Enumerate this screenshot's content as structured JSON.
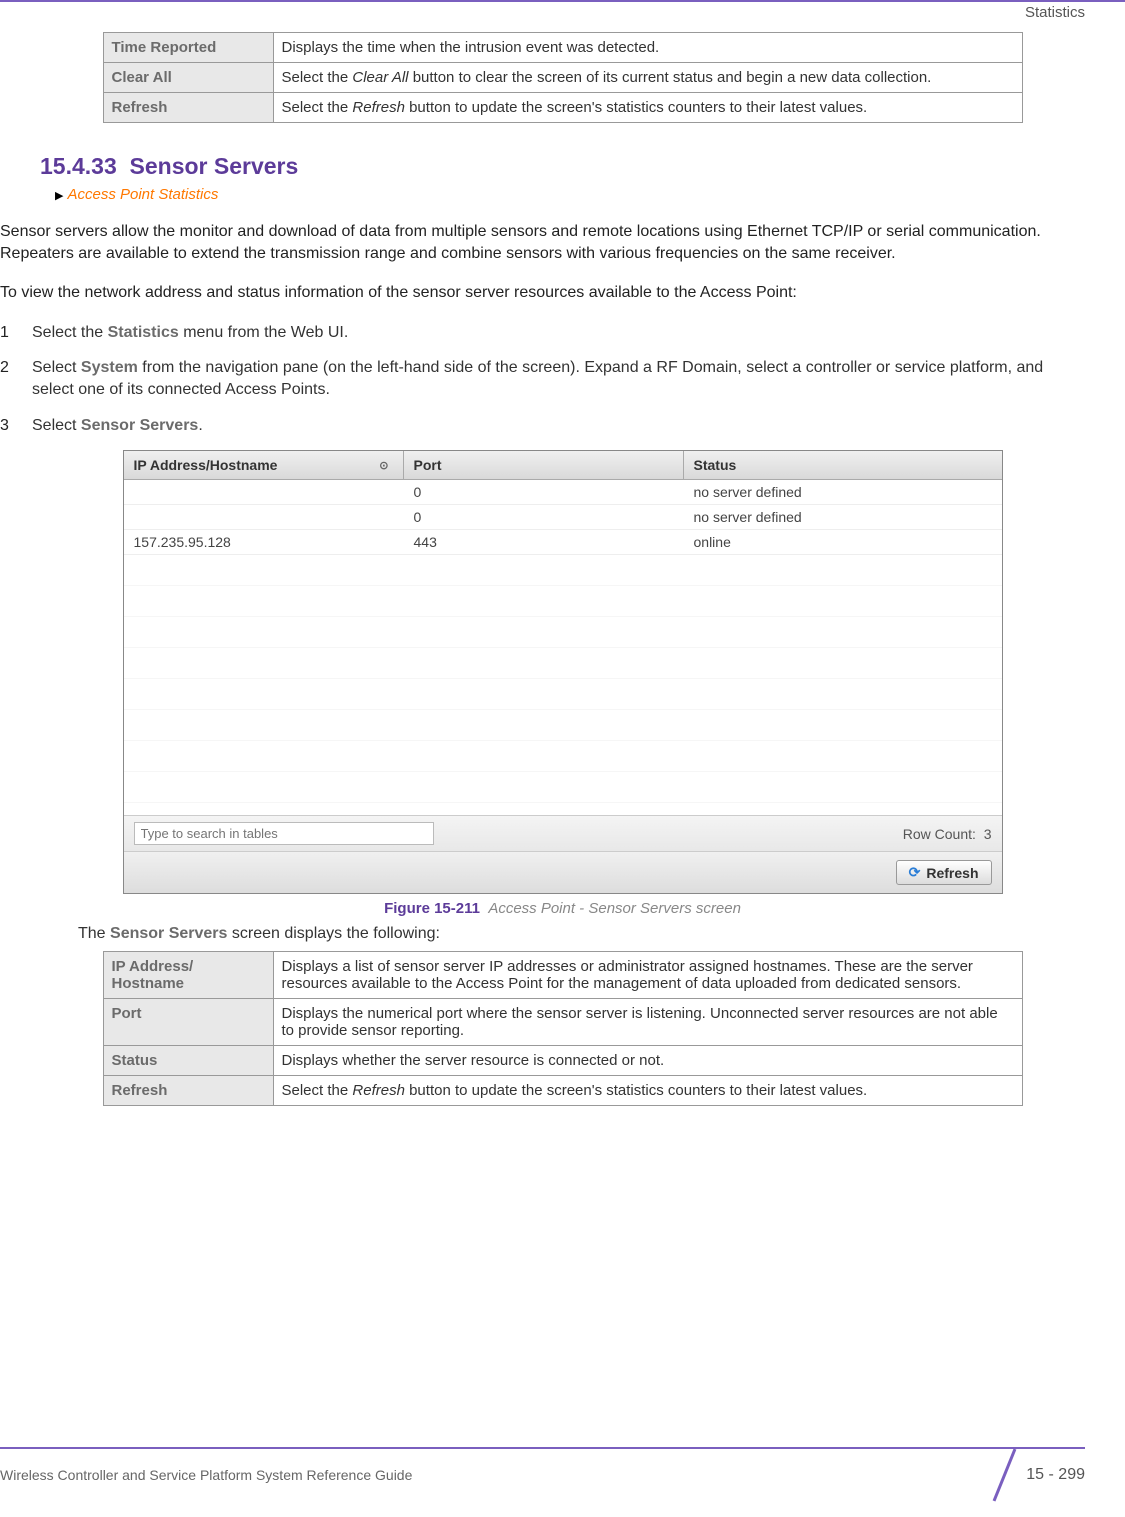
{
  "header": {
    "section_label": "Statistics"
  },
  "table1": {
    "rows": [
      {
        "label": "Time Reported",
        "desc": "Displays the time when the intrusion event was detected."
      },
      {
        "label": "Clear All",
        "desc_parts": [
          "Select the ",
          "Clear All",
          " button to clear the screen of its current status and begin a new data collection."
        ]
      },
      {
        "label": "Refresh",
        "desc_parts": [
          "Select the ",
          "Refresh",
          " button to update the screen's statistics counters to their latest values."
        ]
      }
    ]
  },
  "section": {
    "number": "15.4.33",
    "title": "Sensor Servers",
    "breadcrumb": "Access Point Statistics"
  },
  "para1": "Sensor servers allow the monitor and download of data from multiple sensors and remote locations using Ethernet TCP/IP or serial communication. Repeaters are available to extend the transmission range and combine sensors with various frequencies on the same receiver.",
  "para2": "To view the network address and status information of the sensor server resources available to the Access Point:",
  "steps": [
    {
      "pre": "Select the ",
      "bold": "Statistics",
      "post": " menu from the Web UI."
    },
    {
      "pre": "Select ",
      "bold": "System",
      "post": " from the navigation pane (on the left-hand side of the screen). Expand a RF Domain, select a controller or service platform, and select one of its connected Access Points."
    },
    {
      "pre": "Select ",
      "bold": "Sensor Servers",
      "post": "."
    }
  ],
  "screenshot": {
    "headers": {
      "c1": "IP Address/Hostname",
      "c2": "Port",
      "c3": "Status"
    },
    "rows": [
      {
        "c1": "",
        "c2": "0",
        "c3": "no server defined"
      },
      {
        "c1": "",
        "c2": "0",
        "c3": "no server defined"
      },
      {
        "c1": "157.235.95.128",
        "c2": "443",
        "c3": "online"
      }
    ],
    "search_placeholder": "Type to search in tables",
    "row_count_label": "Row Count:",
    "row_count_value": "3",
    "refresh_label": "Refresh"
  },
  "figure": {
    "number": "Figure 15-211",
    "title": "Access Point - Sensor Servers screen"
  },
  "follows": {
    "pre": "The ",
    "bold": "Sensor Servers",
    "post": " screen displays the following:"
  },
  "table2": {
    "rows": [
      {
        "label": "IP Address/\nHostname",
        "desc": "Displays a list of sensor server IP addresses or administrator assigned hostnames. These are the server resources available to the Access Point for the management of data uploaded from dedicated sensors."
      },
      {
        "label": "Port",
        "desc": "Displays the numerical port where the sensor server is listening. Unconnected server resources are not able to provide sensor reporting."
      },
      {
        "label": "Status",
        "desc": "Displays whether the server resource is connected or not."
      },
      {
        "label": "Refresh",
        "desc_parts": [
          "Select the ",
          "Refresh",
          " button to update the screen's statistics counters to their latest values."
        ]
      }
    ]
  },
  "footer": {
    "guide": "Wireless Controller and Service Platform System Reference Guide",
    "page": "15 - 299"
  }
}
